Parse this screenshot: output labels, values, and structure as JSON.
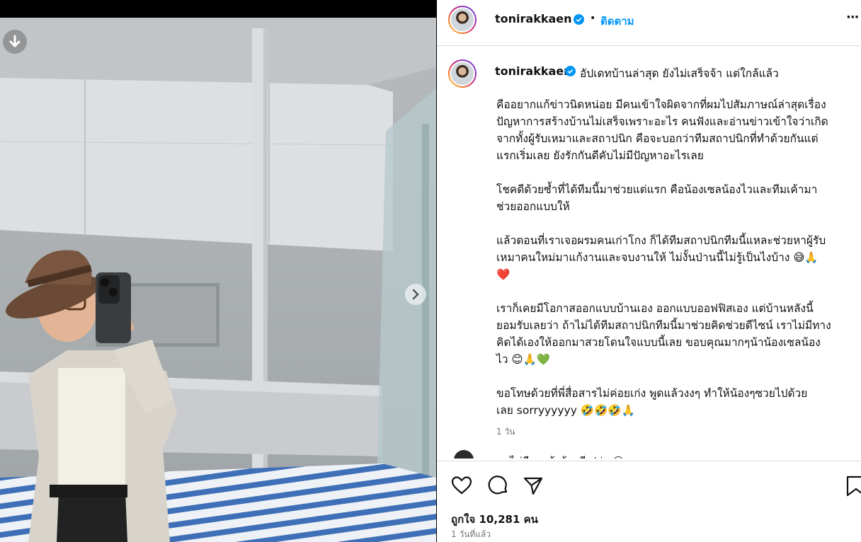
{
  "post": {
    "username": "tonirakkaen",
    "separator": "•",
    "follow_label": "ติดตาม",
    "more_label": "···",
    "caption_title": "อัปเดทบ้านล่าสุด ยังไม่เสร็จจ้า แต่ใกล้แล้ว",
    "caption_paragraphs": [
      "คืออยากแก้ข่าวนิดหน่อย มีคนเข้าใจผิดจากที่ผมไปสัมภาษณ์ล่าสุดเรื่อง\nปัญหาการสร้างบ้านไม่เสร็จเพราะอะไร คนฟังและอ่านข่าวเข้าใจว่าเกิด\nจากทั้งผู้รับเหมาและสถาปนิก คือจะบอกว่าทีมสถาปนิกที่ทำด้วยกันแต่\nแรกเริ่มเลย ยังรักกันดีคับไม่มีปัญหาอะไรเลย",
      "โชคดีด้วยซ้ำที่ได้ทีมนี้มาช่วยแต่แรก คือน้องเซลน้องไวและทีมเค้ามา\nช่วยออกแบบให้",
      "แล้วตอนที่เราเจอผรมคนเก่าโกง ก็ได้ทีมสถาปนิกทีมนี้แหละช่วยหาผู้รับ\nเหมาคนใหม่มาแก้งานและจบงานให้ ไม่งั้นป่านนี้ไม่รู้เป็นไงบ้าง 😅🙏\n❤️",
      "เราก็เคยมีโอกาสออกแบบบ้านเอง ออกแบบออฟฟิสเอง แต่บ้านหลังนี้\nยอมรับเลยว่า ถ้าไม่ได้ทีมสถาปนิกทีมนี้มาช่วยคิดช่วยดีไซน์ เราไม่มีทาง\nคิดได้เองให้ออกมาสวยโดนใจแบบนี้เลย ขอบคุณมากๆน้าน้องเซลน้อง\nไว 😊🙏💚",
      "ขอโทษด้วยที่พี่สื่อสารไม่ค่อยเก่ง พูดแล้วงงๆ ทำให้น้องๆซวยไปด้วย\nเลย sorryyyyyy 🤣🤣🤣🙏"
    ],
    "caption_time": "1 วัน",
    "comment_preview": "... ไม่มีรถหล้อร้าวมีเปล่า 😂",
    "likes_label": "ถูกใจ 10,281 คน",
    "posted_time": "1 วันที่แล้ว",
    "icons": [
      "download-icon",
      "carousel-next-icon",
      "more-options-icon",
      "verified-badge-icon",
      "heart-icon",
      "comment-icon",
      "share-icon",
      "save-icon"
    ]
  }
}
